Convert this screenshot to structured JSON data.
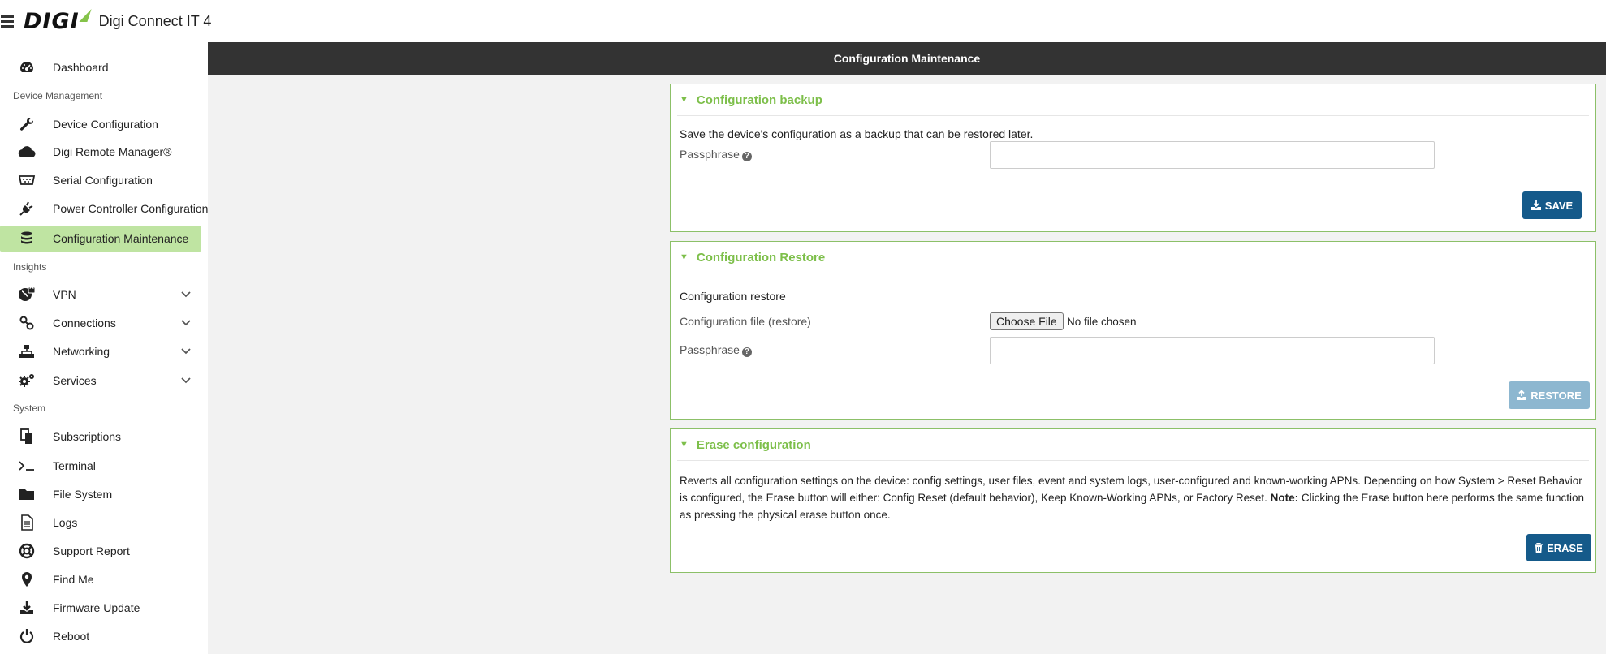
{
  "app": {
    "logo": "DIGI",
    "title": "Digi Connect IT 4"
  },
  "sidebar": {
    "dashboard": "Dashboard",
    "section_device": "Device Management",
    "device_config": "Device Configuration",
    "drm": "Digi Remote Manager®",
    "serial": "Serial Configuration",
    "power": "Power Controller Configuration",
    "config_maint": "Configuration Maintenance",
    "section_insights": "Insights",
    "vpn": "VPN",
    "connections": "Connections",
    "networking": "Networking",
    "services": "Services",
    "section_system": "System",
    "subscriptions": "Subscriptions",
    "terminal": "Terminal",
    "filesystem": "File System",
    "logs": "Logs",
    "support": "Support Report",
    "findme": "Find Me",
    "firmware": "Firmware Update",
    "reboot": "Reboot"
  },
  "main": {
    "header": "Configuration Maintenance",
    "backup": {
      "title": "Configuration backup",
      "description": "Save the device's configuration as a backup that can be restored later.",
      "passphrase_label": "Passphrase",
      "passphrase_value": "",
      "save_label": "SAVE"
    },
    "restore": {
      "title": "Configuration Restore",
      "subtitle": "Configuration restore",
      "file_label": "Configuration file (restore)",
      "choose_file": "Choose File",
      "no_file": "No file chosen",
      "passphrase_label": "Passphrase",
      "passphrase_value": "",
      "restore_label": "RESTORE"
    },
    "erase": {
      "title": "Erase configuration",
      "desc_part1": "Reverts all configuration settings on the device: config settings, user files, event and system logs, user-configured and known-working APNs. Depending on how System > Reset Behavior is configured, the Erase button will either: Config Reset (default behavior), Keep Known-Working APNs, or Factory Reset. ",
      "note_label": "Note:",
      "desc_part2": " Clicking the Erase button here performs the same function as pressing the physical erase button once.",
      "erase_label": "ERASE"
    }
  },
  "colors": {
    "accent_green": "#7dbf4a",
    "active_nav": "#bfe4a2",
    "primary_btn": "#155a8a",
    "header_bar": "#333333"
  }
}
